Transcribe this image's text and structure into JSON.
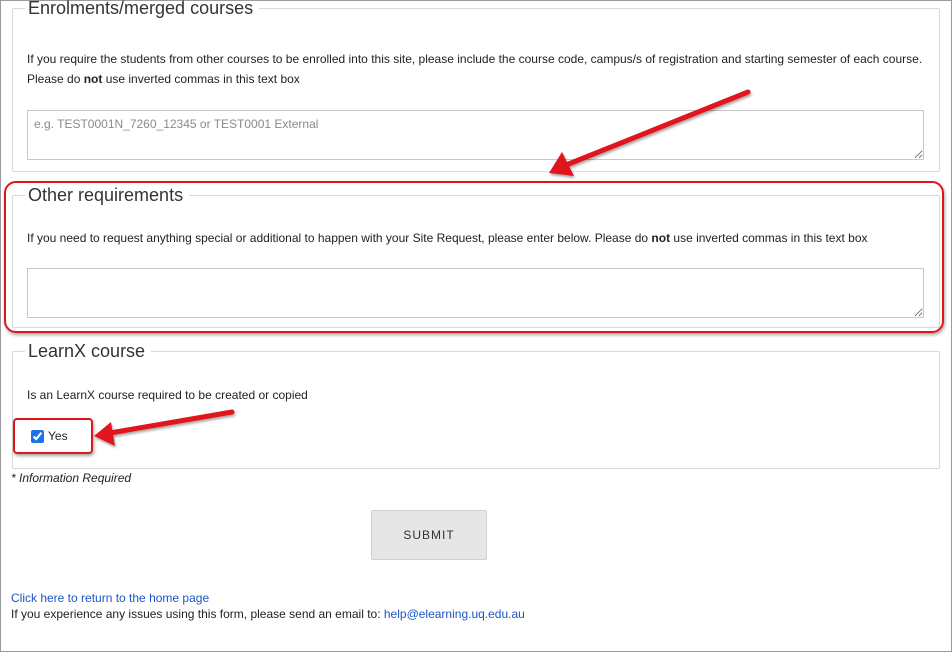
{
  "sections": {
    "enrolments": {
      "legend": "Enrolments/merged courses",
      "desc_line1": "If you require the students from other courses to be enrolled into this site, please include the course code, campus/s of registration and starting semester of each course.",
      "desc_line2_pre": "Please do ",
      "desc_line2_bold": "not",
      "desc_line2_post": " use inverted commas in this text box",
      "placeholder": "e.g. TEST0001N_7260_12345 or TEST0001 External"
    },
    "other": {
      "legend": "Other requirements",
      "desc_pre": "If you need to request anything special or additional to happen with your Site Request, please enter below. Please do ",
      "desc_bold": "not",
      "desc_post": " use inverted commas in this text box",
      "placeholder": ""
    },
    "learnx": {
      "legend": "LearnX course",
      "desc": "Is an LearnX course required to be created or copied",
      "checkbox_label": "Yes",
      "checked": true
    }
  },
  "required_note": "* Information Required",
  "submit_label": "SUBMIT",
  "footer": {
    "home_link": "Click here to return to the home page",
    "issues_text": "If you experience any issues using this form, please send an email to: ",
    "email": "help@elearning.uq.edu.au"
  },
  "annotation_color": "#e0151c"
}
